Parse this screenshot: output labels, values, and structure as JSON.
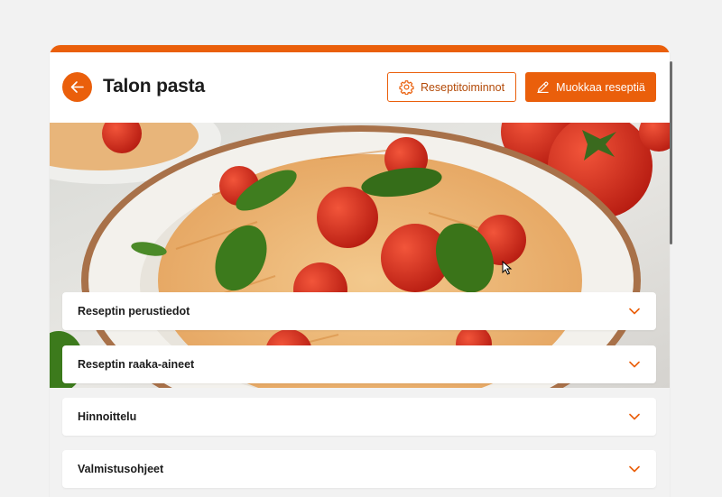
{
  "colors": {
    "accent": "#ea5f0b",
    "background": "#f2f2f2",
    "card": "#ffffff",
    "text": "#1c1c1c"
  },
  "header": {
    "back_icon": "arrow-left-icon",
    "title": "Talon pasta",
    "options_button": {
      "label": "Reseptitoiminnot",
      "icon": "gear-icon"
    },
    "edit_button": {
      "label": "Muokkaa reseptiä",
      "icon": "pencil-icon"
    }
  },
  "hero_image": {
    "subject": "pasta-dish-with-tomatoes-and-basil"
  },
  "sections": [
    {
      "title": "Reseptin perustiedot",
      "icon": "chevron-down-icon"
    },
    {
      "title": "Reseptin raaka-aineet",
      "icon": "chevron-down-icon"
    },
    {
      "title": "Hinnoittelu",
      "icon": "chevron-down-icon"
    },
    {
      "title": "Valmistusohjeet",
      "icon": "chevron-down-icon"
    }
  ]
}
